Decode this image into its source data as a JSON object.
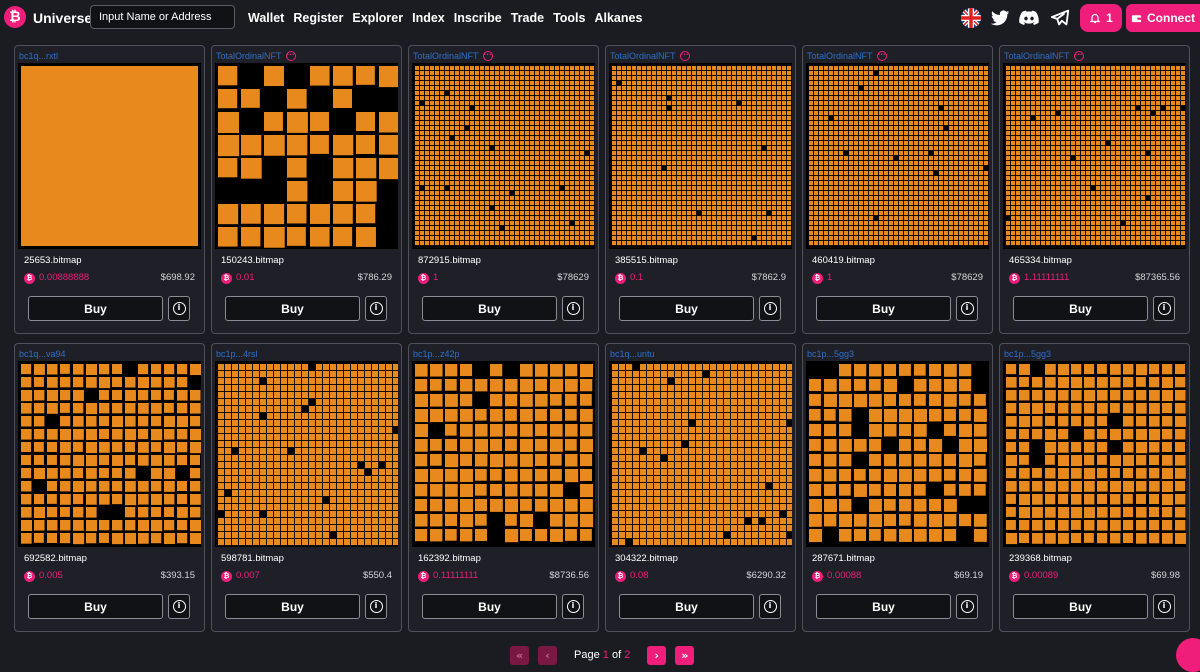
{
  "header": {
    "brand": "Universe",
    "search_placeholder": "Input Name or Address",
    "nav": [
      "Wallet",
      "Register",
      "Explorer",
      "Index",
      "Inscribe",
      "Trade",
      "Tools",
      "Alkanes"
    ],
    "notification_count": "1",
    "connect_label": "Connect",
    "icons": [
      "bitcoin-logo-icon",
      "uk-flag-icon",
      "twitter-icon",
      "discord-icon",
      "telegram-icon",
      "bell-icon",
      "wallet-icon"
    ]
  },
  "cards": [
    {
      "owner": "bc1q...rxtl",
      "verified": false,
      "name": "25653.bitmap",
      "btc": "0.00888888",
      "usd": "$698.92",
      "buy": "Buy",
      "art": "solid"
    },
    {
      "owner": "TotalOrdinalNFT",
      "verified": true,
      "name": "150243.bitmap",
      "btc": "0.01",
      "usd": "$786.29",
      "buy": "Buy",
      "art": "large"
    },
    {
      "owner": "TotalOrdinalNFT",
      "verified": true,
      "name": "872915.bitmap",
      "btc": "1",
      "usd": "$78629",
      "buy": "Buy",
      "art": "dense"
    },
    {
      "owner": "TotalOrdinalNFT",
      "verified": true,
      "name": "385515.bitmap",
      "btc": "0.1",
      "usd": "$7862.9",
      "buy": "Buy",
      "art": "dense"
    },
    {
      "owner": "TotalOrdinalNFT",
      "verified": true,
      "name": "460419.bitmap",
      "btc": "1",
      "usd": "$78629",
      "buy": "Buy",
      "art": "dense"
    },
    {
      "owner": "TotalOrdinalNFT",
      "verified": true,
      "name": "465334.bitmap",
      "btc": "1.11111111",
      "usd": "$87365.56",
      "buy": "Buy",
      "art": "dense"
    },
    {
      "owner": "bc1q...va94",
      "verified": false,
      "name": "692582.bitmap",
      "btc": "0.005",
      "usd": "$393.15",
      "buy": "Buy",
      "art": "mixed"
    },
    {
      "owner": "bc1p...4rsl",
      "verified": false,
      "name": "598781.bitmap",
      "btc": "0.007",
      "usd": "$550.4",
      "buy": "Buy",
      "art": "fine"
    },
    {
      "owner": "bc1p...z42p",
      "verified": false,
      "name": "162392.bitmap",
      "btc": "0.11111111",
      "usd": "$8736.56",
      "buy": "Buy",
      "art": "medium"
    },
    {
      "owner": "bc1q...untu",
      "verified": false,
      "name": "304322.bitmap",
      "btc": "0.08",
      "usd": "$6290.32",
      "buy": "Buy",
      "art": "fine"
    },
    {
      "owner": "bc1p...5gg3",
      "verified": false,
      "name": "287671.bitmap",
      "btc": "0.00088",
      "usd": "$69.19",
      "buy": "Buy",
      "art": "medium"
    },
    {
      "owner": "bc1p...5gg3",
      "verified": false,
      "name": "239368.bitmap",
      "btc": "0.00089",
      "usd": "$69.98",
      "buy": "Buy",
      "art": "mixed"
    }
  ],
  "pagination": {
    "label": "Page",
    "current": "1",
    "of": "of",
    "total": "2"
  },
  "colors": {
    "accent": "#ee1e7a",
    "bitmap_orange": "#e8891d",
    "link_blue": "#2e6fc7",
    "background": "#1b1c22"
  }
}
